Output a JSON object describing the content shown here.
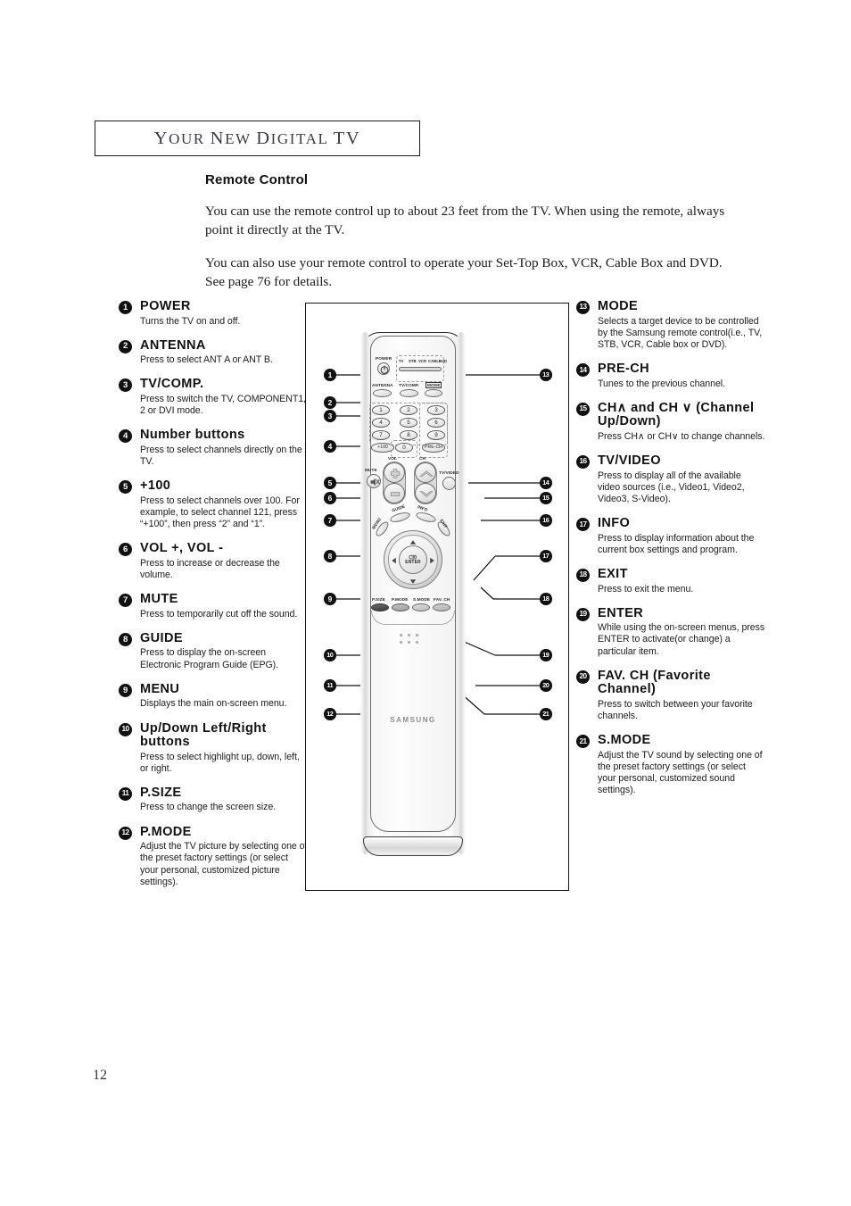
{
  "header": {
    "title": "Your New Digital TV"
  },
  "intro": {
    "heading": "Remote Control",
    "paragraph1": "You can use the remote control up to about 23 feet from the TV. When using the remote, always point it directly at the TV.",
    "paragraph2": "You can also use your remote control to operate your Set-Top Box, VCR, Cable Box and DVD. See page 76 for details."
  },
  "page_number": "12",
  "left_column": [
    {
      "num": "1",
      "title": "POWER",
      "desc": "Turns the TV on and off."
    },
    {
      "num": "2",
      "title": "ANTENNA",
      "desc": "Press to select ANT A or ANT B."
    },
    {
      "num": "3",
      "title": "TV/COMP.",
      "desc": "Press to switch the TV, COMPONENT1, 2 or DVI mode."
    },
    {
      "num": "4",
      "title": "Number buttons",
      "desc": "Press to select channels directly on the TV."
    },
    {
      "num": "5",
      "title": "+100",
      "desc": "Press to select channels over 100. For example, to select channel 121, press “+100”, then press “2” and “1”."
    },
    {
      "num": "6",
      "title": "VOL +, VOL -",
      "desc": "Press to increase or decrease the volume."
    },
    {
      "num": "7",
      "title": "MUTE",
      "desc": "Press to temporarily cut off the sound."
    },
    {
      "num": "8",
      "title": "GUIDE",
      "desc": "Press to display the on-screen Electronic Program Guide (EPG)."
    },
    {
      "num": "9",
      "title": "MENU",
      "desc": "Displays the main on-screen menu."
    },
    {
      "num": "10",
      "title": "Up/Down Left/Right buttons",
      "desc": "Press to select highlight up, down, left, or right."
    },
    {
      "num": "11",
      "title": "P.SIZE",
      "desc": "Press to change the screen size."
    },
    {
      "num": "12",
      "title": "P.MODE",
      "desc": "Adjust the TV picture by selecting one of the preset factory settings (or select your personal, customized picture settings)."
    }
  ],
  "right_column": [
    {
      "num": "13",
      "title": "MODE",
      "desc": "Selects a target device to be controlled by the Samsung remote control(i.e., TV, STB, VCR, Cable box or DVD)."
    },
    {
      "num": "14",
      "title": "PRE-CH",
      "desc": "Tunes to the previous channel."
    },
    {
      "num": "15",
      "title": "CH∧ and CH ∨ (Channel Up/Down)",
      "desc": "Press CH∧ or CH∨ to change channels."
    },
    {
      "num": "16",
      "title": "TV/VIDEO",
      "desc": "Press to display all of the available video sources (i.e., Video1, Video2, Video3, S-Video)."
    },
    {
      "num": "17",
      "title": "INFO",
      "desc": "Press to display information about the current box settings and program."
    },
    {
      "num": "18",
      "title": "EXIT",
      "desc": "Press to exit the menu."
    },
    {
      "num": "19",
      "title": "ENTER",
      "desc": "While using the on-screen menus, press ENTER to activate(or change) a particular item."
    },
    {
      "num": "20",
      "title": "FAV. CH (Favorite Channel)",
      "desc": "Press to switch between your favorite channels."
    },
    {
      "num": "21",
      "title": "S.MODE",
      "desc": "Adjust the TV sound by selecting one of the preset factory settings (or select your personal, customized sound settings)."
    }
  ],
  "remote": {
    "brand": "SAMSUNG",
    "labels": {
      "power": "POWER",
      "antenna": "ANTENNA",
      "tvcomp": "TV/COMP.",
      "mode": "MODE",
      "plus100": "+100",
      "precH": "PRE-CH",
      "vol": "VOL",
      "ch": "CH",
      "mute": "MUTE",
      "tvvideo": "TV/VIDEO",
      "guide": "GUIDE",
      "info": "INFO",
      "menu": "MENU",
      "exit": "EXIT",
      "enter": "ENTER",
      "psize": "P.SIZE",
      "pmode": "P.MODE",
      "smode": "S.MODE",
      "favch": "FAV. CH"
    },
    "mode_devices": [
      "TV",
      "STB",
      "VCR",
      "CABLE",
      "DVD"
    ],
    "keypad": [
      "1",
      "2",
      "3",
      "4",
      "5",
      "6",
      "7",
      "8",
      "9",
      "0"
    ],
    "callouts_left": [
      "1",
      "2",
      "3",
      "4",
      "5",
      "6",
      "7",
      "8",
      "9",
      "10",
      "11",
      "12"
    ],
    "callouts_right": [
      "13",
      "14",
      "15",
      "16",
      "17",
      "18",
      "19",
      "20",
      "21"
    ]
  }
}
